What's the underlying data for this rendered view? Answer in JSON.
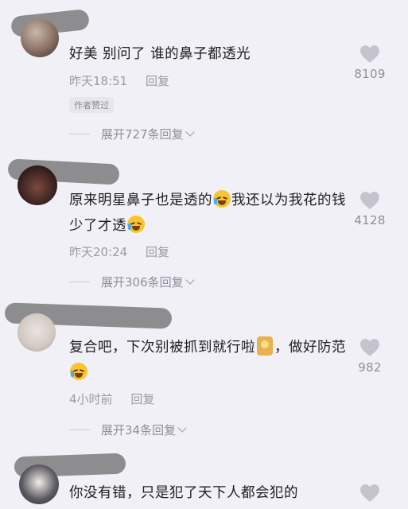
{
  "colors": {
    "background": "#f0f0f6",
    "text": "#1e1e1e",
    "meta": "#9a9aa3",
    "heart": "#c4c4cc"
  },
  "comments": [
    {
      "text": "好美  别问了  谁的鼻子都透光",
      "time": "昨天18:51",
      "reply_label": "回复",
      "badge": "作者赞过",
      "expand_label": "展开727条回复",
      "likes": "8109"
    },
    {
      "text_part1": "原来明星鼻子也是透的",
      "text_part2": "我还以为我花的钱少了才透",
      "time": "昨天20:24",
      "reply_label": "回复",
      "expand_label": "展开306条回复",
      "likes": "4128"
    },
    {
      "text_part1": "复合吧，下次别被抓到就行啦",
      "text_part2": "，做好防范",
      "time": "4小时前",
      "reply_label": "回复",
      "expand_label": "展开34条回复",
      "likes": "982"
    },
    {
      "text": "你没有错，只是犯了天下人都会犯的"
    }
  ]
}
